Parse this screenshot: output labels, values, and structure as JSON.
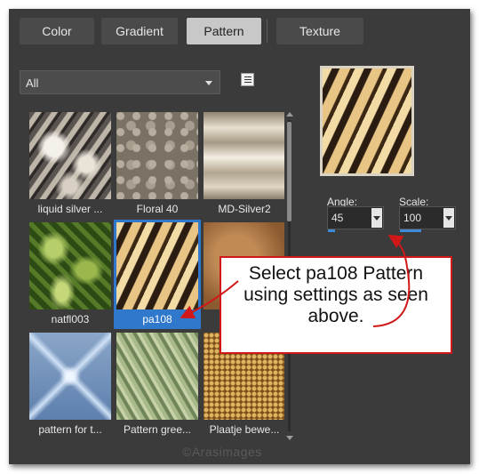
{
  "tabs": [
    {
      "label": "Color",
      "active": false
    },
    {
      "label": "Gradient",
      "active": false
    },
    {
      "label": "Pattern",
      "active": true
    },
    {
      "label": "Texture",
      "active": false
    }
  ],
  "category_select": {
    "value": "All"
  },
  "patterns": [
    {
      "label": "liquid silver ...",
      "selected": false
    },
    {
      "label": "Floral 40",
      "selected": false
    },
    {
      "label": "MD-Silver2",
      "selected": false
    },
    {
      "label": "natfl003",
      "selected": false
    },
    {
      "label": "pa108",
      "selected": true
    },
    {
      "label": "",
      "selected": false
    },
    {
      "label": "pattern for t...",
      "selected": false
    },
    {
      "label": "Pattern gree...",
      "selected": false
    },
    {
      "label": "Plaatje bewe...",
      "selected": false
    }
  ],
  "angle": {
    "label": "Angle:",
    "value": "45"
  },
  "scale": {
    "label": "Scale:",
    "value": "100"
  },
  "callout": {
    "lines": [
      "Select pa108 Pattern",
      "using settings as seen",
      "above."
    ],
    "border_color": "#d01818"
  },
  "watermark": "©Arasimages",
  "colors": {
    "selection": "#2f78cc",
    "panel": "#3b3b3b",
    "arrow": "#d01818"
  }
}
